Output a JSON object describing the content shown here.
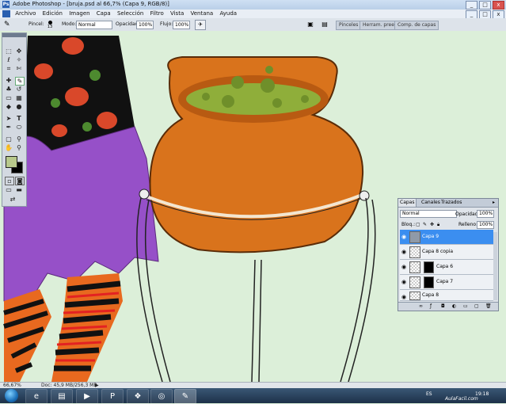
{
  "titlebar": {
    "app_icon": "Ps",
    "title": "Adobe Photoshop - [bruja.psd al 66,7% (Capa 9, RGB/8)]",
    "buttons": [
      "_",
      "□",
      "x"
    ]
  },
  "menubar": {
    "items": [
      "Archivo",
      "Edición",
      "Imagen",
      "Capa",
      "Selección",
      "Filtro",
      "Vista",
      "Ventana",
      "Ayuda"
    ]
  },
  "options": {
    "brush_label": "Pincel:",
    "brush_size": "13",
    "mode_label": "Modo:",
    "mode_value": "Normal",
    "opacity_label": "Opacidad:",
    "opacity_value": "100%",
    "flow_label": "Flujo:",
    "flow_value": "100%",
    "dock_tabs": [
      "Pinceles",
      "Herram. preest.",
      "Comp. de capas"
    ]
  },
  "toolbox": {
    "icons": [
      "move-icon",
      "marquee-icon",
      "lasso-icon",
      "magic-wand-icon",
      "crop-icon",
      "slice-icon",
      "healing-icon",
      "brush-icon",
      "stamp-icon",
      "history-brush-icon",
      "eraser-icon",
      "gradient-icon",
      "blur-icon",
      "dodge-icon",
      "path-select-icon",
      "type-icon",
      "pen-icon",
      "shape-icon",
      "notes-icon",
      "eyedropper-icon",
      "hand-icon",
      "zoom-icon"
    ],
    "foreground_color": "#b8c98c",
    "background_color": "#000000"
  },
  "layers_panel": {
    "tabs": [
      "Capas",
      "Canales",
      "Trazados"
    ],
    "blend_mode": "Normal",
    "opacity_label": "Opacidad:",
    "opacity_value": "100%",
    "lock_label": "Bloq.:",
    "fill_label": "Relleno:",
    "fill_value": "100%",
    "layers": [
      {
        "name": "Capa 9",
        "active": true,
        "mask": false
      },
      {
        "name": "Capa 8 copia",
        "active": false,
        "mask": false
      },
      {
        "name": "Capa 6",
        "active": false,
        "mask": true
      },
      {
        "name": "Capa 7",
        "active": false,
        "mask": true
      },
      {
        "name": "Capa 8",
        "active": false,
        "mask": false
      }
    ]
  },
  "statusbar": {
    "zoom": "66,67%",
    "doc_info": "Doc: 45,9 MB/256,3 MB"
  },
  "taskbar": {
    "language": "ES",
    "time": "19:18",
    "watermark": "AulaFacil.com"
  },
  "colors": {
    "canvas_bg": "#dcefd9",
    "cauldron": "#d9731c",
    "potion": "#8fae3a",
    "dress": "#9650c8",
    "accent_layer": "#3b8ef0"
  }
}
